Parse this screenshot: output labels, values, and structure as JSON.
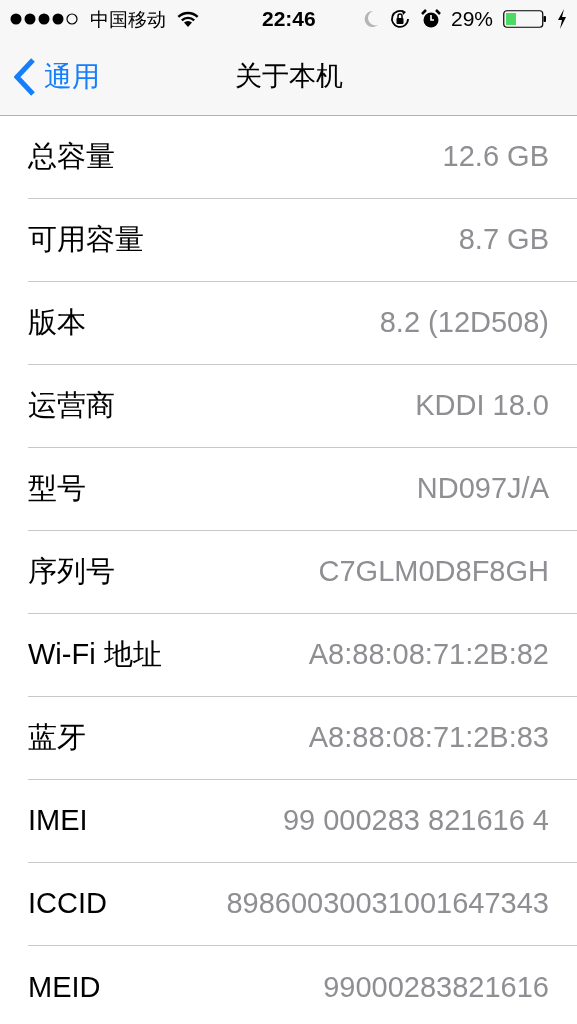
{
  "status_bar": {
    "carrier": "中国移动",
    "time": "22:46",
    "battery": "29%"
  },
  "nav_bar": {
    "back": "通用",
    "title": "关于本机"
  },
  "rows": [
    {
      "label": "总容量",
      "value": "12.6 GB"
    },
    {
      "label": "可用容量",
      "value": "8.7 GB"
    },
    {
      "label": "版本",
      "value": "8.2 (12D508)"
    },
    {
      "label": "运营商",
      "value": "KDDI 18.0"
    },
    {
      "label": "型号",
      "value": "ND097J/A"
    },
    {
      "label": "序列号",
      "value": "C7GLM0D8F8GH"
    },
    {
      "label": "Wi-Fi 地址",
      "value": "A8:88:08:71:2B:82"
    },
    {
      "label": "蓝牙",
      "value": "A8:88:08:71:2B:83"
    },
    {
      "label": "IMEI",
      "value": "99 000283 821616 4"
    },
    {
      "label": "ICCID",
      "value": "89860030031001647343"
    },
    {
      "label": "MEID",
      "value": "99000283821616"
    }
  ]
}
